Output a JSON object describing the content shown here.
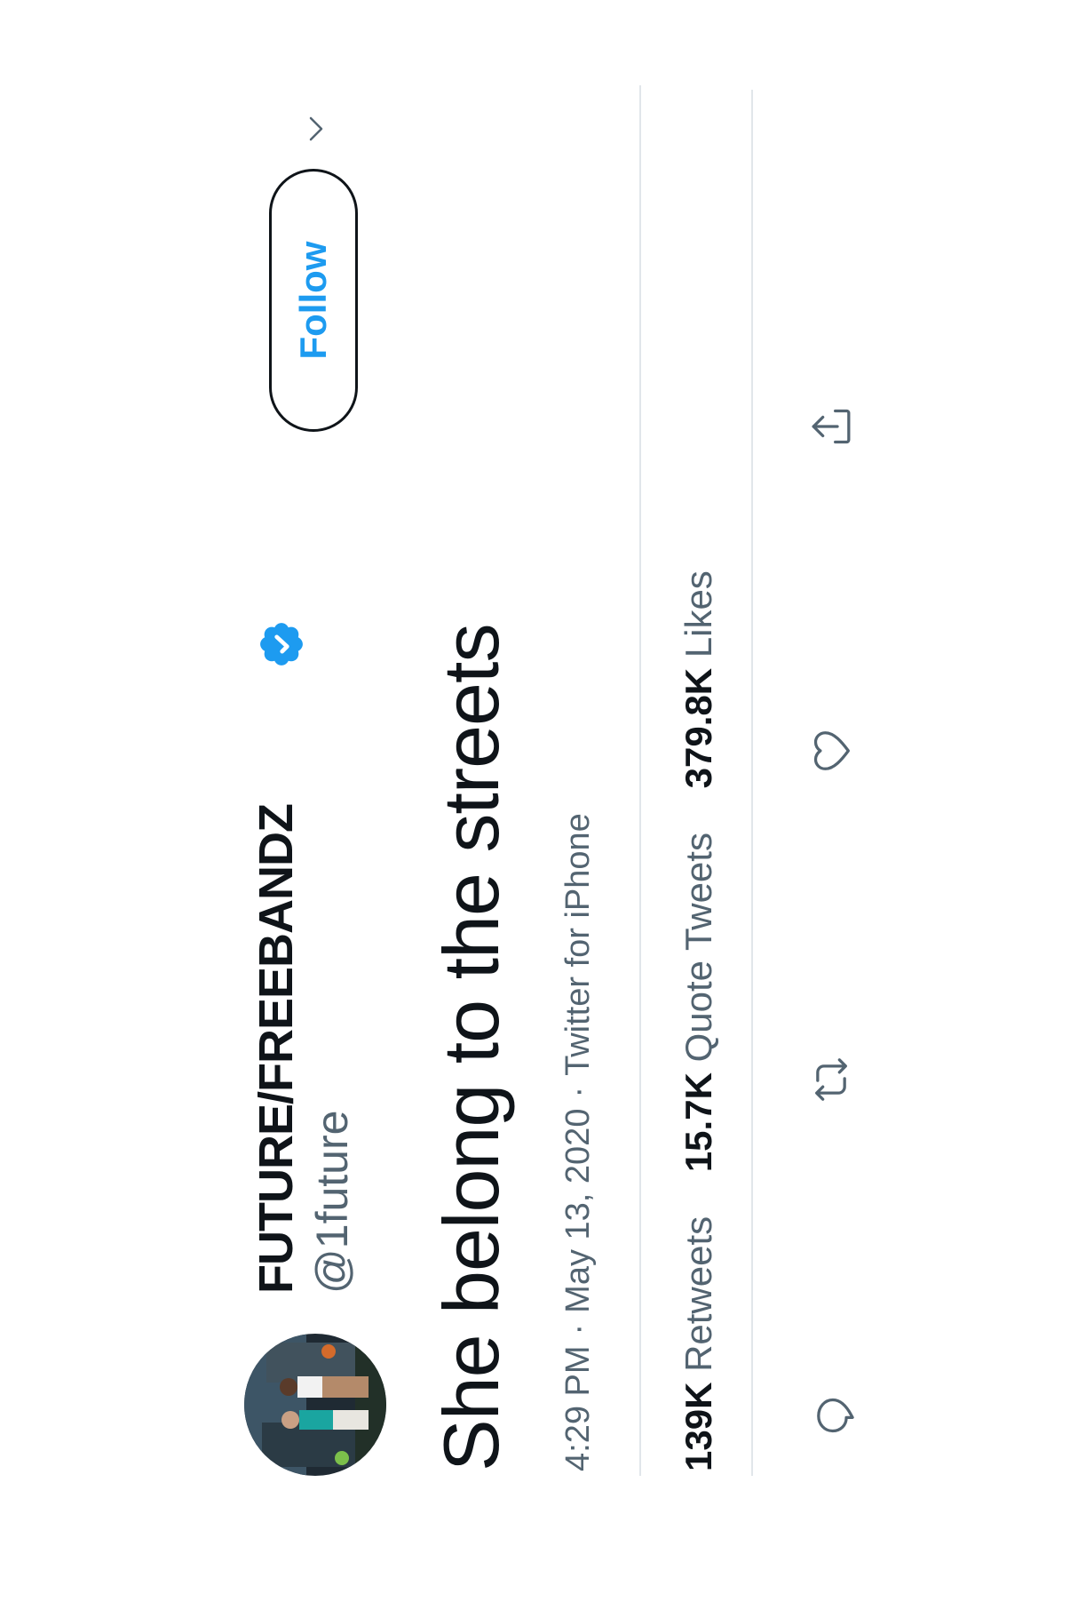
{
  "author": {
    "display_name": "FUTURE/FREEBANDZ",
    "handle": "@1future",
    "verified": true
  },
  "follow_button": {
    "label": "Follow"
  },
  "tweet": {
    "text": "She belong to the streets",
    "time": "4:29 PM",
    "date": "May 13, 2020",
    "source": "Twitter for iPhone",
    "separator": "·"
  },
  "stats": {
    "retweets_count": "139K",
    "retweets_label": "Retweets",
    "quotes_count": "15.7K",
    "quotes_label": "Quote Tweets",
    "likes_count": "379.8K",
    "likes_label": "Likes"
  },
  "actions": [
    "reply-icon",
    "retweet-icon",
    "like-icon",
    "share-icon"
  ],
  "colors": {
    "text_primary": "#0f1419",
    "text_secondary": "#536471",
    "accent": "#1d9bf0",
    "icon": "#536471",
    "divider": "#e1e6ea"
  }
}
